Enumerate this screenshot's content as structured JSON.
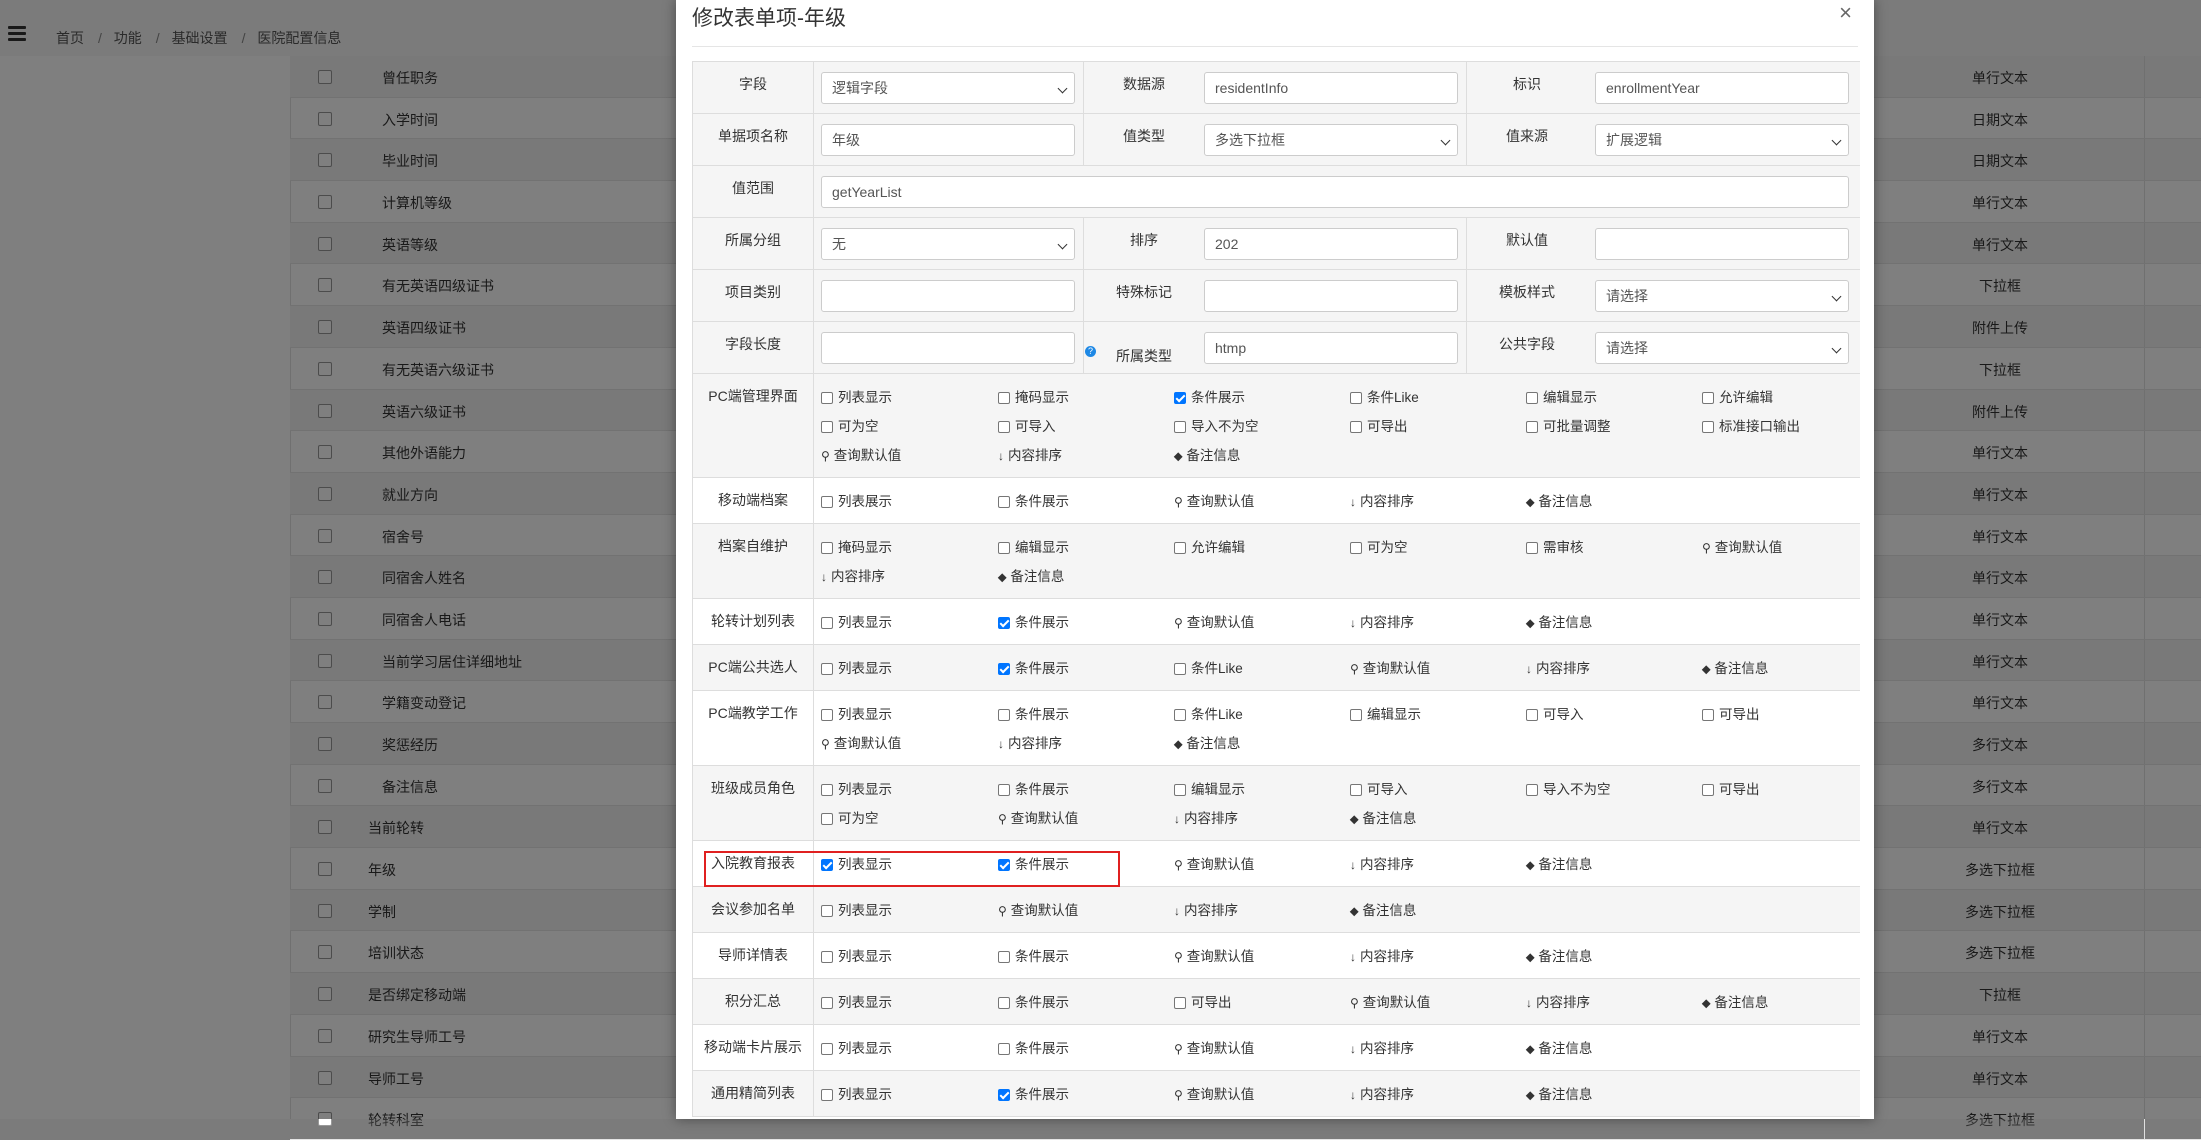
{
  "breadcrumb": [
    "首页",
    "功能",
    "基础设置",
    "医院配置信息"
  ],
  "background_rows": [
    {
      "name": "曾任职务",
      "type": "单行文本",
      "indent": true
    },
    {
      "name": "入学时间",
      "type": "日期文本",
      "indent": true
    },
    {
      "name": "毕业时间",
      "type": "日期文本",
      "indent": true
    },
    {
      "name": "计算机等级",
      "type": "单行文本",
      "indent": true
    },
    {
      "name": "英语等级",
      "type": "单行文本",
      "indent": true
    },
    {
      "name": "有无英语四级证书",
      "type": "下拉框",
      "indent": true
    },
    {
      "name": "英语四级证书",
      "type": "附件上传",
      "indent": true
    },
    {
      "name": "有无英语六级证书",
      "type": "下拉框",
      "indent": true
    },
    {
      "name": "英语六级证书",
      "type": "附件上传",
      "indent": true
    },
    {
      "name": "其他外语能力",
      "type": "单行文本",
      "indent": true
    },
    {
      "name": "就业方向",
      "type": "单行文本",
      "indent": true
    },
    {
      "name": "宿舍号",
      "type": "单行文本",
      "indent": true
    },
    {
      "name": "同宿舍人姓名",
      "type": "单行文本",
      "indent": true
    },
    {
      "name": "同宿舍人电话",
      "type": "单行文本",
      "indent": true
    },
    {
      "name": "当前学习居住详细地址",
      "type": "单行文本",
      "indent": true
    },
    {
      "name": "学籍变动登记",
      "type": "单行文本",
      "indent": true
    },
    {
      "name": "奖惩经历",
      "type": "多行文本",
      "indent": true
    },
    {
      "name": "备注信息",
      "type": "多行文本",
      "indent": true
    },
    {
      "name": "当前轮转",
      "type": "单行文本",
      "indent": false
    },
    {
      "name": "年级",
      "type": "多选下拉框",
      "indent": false
    },
    {
      "name": "学制",
      "type": "多选下拉框",
      "indent": false
    },
    {
      "name": "培训状态",
      "type": "多选下拉框",
      "indent": false
    },
    {
      "name": "是否绑定移动端",
      "type": "下拉框",
      "indent": false
    },
    {
      "name": "研究生导师工号",
      "type": "单行文本",
      "indent": false
    },
    {
      "name": "导师工号",
      "type": "单行文本",
      "indent": false
    },
    {
      "name": "轮转科室",
      "type": "多选下拉框",
      "indent": false
    }
  ],
  "modal": {
    "title": "修改表单项-年级",
    "close": "×",
    "fields": {
      "field_label": "字段",
      "field_value": "逻辑字段",
      "datasource_label": "数据源",
      "datasource_value": "residentInfo",
      "identifier_label": "标识",
      "identifier_value": "enrollmentYear",
      "name_label": "单据项名称",
      "name_value": "年级",
      "valtype_label": "值类型",
      "valtype_value": "多选下拉框",
      "valsource_label": "值来源",
      "valsource_value": "扩展逻辑",
      "range_label": "值范围",
      "range_value": "getYearList",
      "group_label": "所属分组",
      "group_value": "无",
      "order_label": "排序",
      "order_value": "202",
      "default_label": "默认值",
      "default_value": "",
      "category_label": "项目类别",
      "category_value": "",
      "special_label": "特殊标记",
      "special_value": "",
      "template_label": "模板样式",
      "template_value": "请选择",
      "length_label": "字段长度",
      "length_value": "",
      "owntype_label": "所属类型",
      "owntype_help": "?",
      "owntype_value": "htmp",
      "public_label": "公共字段",
      "public_value": "请选择"
    },
    "sections": [
      {
        "label": "PC端管理界面",
        "items": [
          {
            "t": "c",
            "text": "列表显示",
            "on": false
          },
          {
            "t": "c",
            "text": "掩码显示",
            "on": false
          },
          {
            "t": "c",
            "text": "条件展示",
            "on": true
          },
          {
            "t": "c",
            "text": "条件Like",
            "on": false
          },
          {
            "t": "c",
            "text": "编辑显示",
            "on": false
          },
          {
            "t": "c",
            "text": "允许编辑",
            "on": false
          },
          {
            "t": "c",
            "text": "可为空",
            "on": false
          },
          {
            "t": "c",
            "text": "可导入",
            "on": false
          },
          {
            "t": "c",
            "text": "导入不为空",
            "on": false
          },
          {
            "t": "c",
            "text": "可导出",
            "on": false
          },
          {
            "t": "c",
            "text": "可批量调整",
            "on": false
          },
          {
            "t": "c",
            "text": "标准接口输出",
            "on": false
          },
          {
            "t": "q",
            "text": "查询默认值"
          },
          {
            "t": "s",
            "text": "内容排序"
          },
          {
            "t": "g",
            "text": "备注信息"
          }
        ]
      },
      {
        "label": "移动端档案",
        "items": [
          {
            "t": "c",
            "text": "列表展示",
            "on": false
          },
          {
            "t": "c",
            "text": "条件展示",
            "on": false
          },
          {
            "t": "q",
            "text": "查询默认值"
          },
          {
            "t": "s",
            "text": "内容排序"
          },
          {
            "t": "g",
            "text": "备注信息"
          }
        ]
      },
      {
        "label": "档案自维护",
        "items": [
          {
            "t": "c",
            "text": "掩码显示",
            "on": false
          },
          {
            "t": "c",
            "text": "编辑显示",
            "on": false
          },
          {
            "t": "c",
            "text": "允许编辑",
            "on": false
          },
          {
            "t": "c",
            "text": "可为空",
            "on": false
          },
          {
            "t": "c",
            "text": "需审核",
            "on": false
          },
          {
            "t": "q",
            "text": "查询默认值"
          },
          {
            "t": "s",
            "text": "内容排序"
          },
          {
            "t": "g",
            "text": "备注信息"
          }
        ]
      },
      {
        "label": "轮转计划列表",
        "items": [
          {
            "t": "c",
            "text": "列表显示",
            "on": false
          },
          {
            "t": "c",
            "text": "条件展示",
            "on": true
          },
          {
            "t": "q",
            "text": "查询默认值"
          },
          {
            "t": "s",
            "text": "内容排序"
          },
          {
            "t": "g",
            "text": "备注信息"
          }
        ]
      },
      {
        "label": "PC端公共选人",
        "items": [
          {
            "t": "c",
            "text": "列表显示",
            "on": false
          },
          {
            "t": "c",
            "text": "条件展示",
            "on": true
          },
          {
            "t": "c",
            "text": "条件Like",
            "on": false
          },
          {
            "t": "q",
            "text": "查询默认值"
          },
          {
            "t": "s",
            "text": "内容排序"
          },
          {
            "t": "g",
            "text": "备注信息"
          }
        ]
      },
      {
        "label": "PC端教学工作",
        "items": [
          {
            "t": "c",
            "text": "列表显示",
            "on": false
          },
          {
            "t": "c",
            "text": "条件展示",
            "on": false
          },
          {
            "t": "c",
            "text": "条件Like",
            "on": false
          },
          {
            "t": "c",
            "text": "编辑显示",
            "on": false
          },
          {
            "t": "c",
            "text": "可导入",
            "on": false
          },
          {
            "t": "c",
            "text": "可导出",
            "on": false
          },
          {
            "t": "q",
            "text": "查询默认值"
          },
          {
            "t": "s",
            "text": "内容排序"
          },
          {
            "t": "g",
            "text": "备注信息"
          }
        ]
      },
      {
        "label": "班级成员角色",
        "items": [
          {
            "t": "c",
            "text": "列表显示",
            "on": false
          },
          {
            "t": "c",
            "text": "条件展示",
            "on": false
          },
          {
            "t": "c",
            "text": "编辑显示",
            "on": false
          },
          {
            "t": "c",
            "text": "可导入",
            "on": false
          },
          {
            "t": "c",
            "text": "导入不为空",
            "on": false
          },
          {
            "t": "c",
            "text": "可导出",
            "on": false
          },
          {
            "t": "c",
            "text": "可为空",
            "on": false
          },
          {
            "t": "q",
            "text": "查询默认值"
          },
          {
            "t": "s",
            "text": "内容排序"
          },
          {
            "t": "g",
            "text": "备注信息"
          }
        ]
      },
      {
        "label": "入院教育报表",
        "items": [
          {
            "t": "c",
            "text": "列表显示",
            "on": true
          },
          {
            "t": "c",
            "text": "条件展示",
            "on": true
          },
          {
            "t": "q",
            "text": "查询默认值"
          },
          {
            "t": "s",
            "text": "内容排序"
          },
          {
            "t": "g",
            "text": "备注信息"
          }
        ]
      },
      {
        "label": "会议参加名单",
        "items": [
          {
            "t": "c",
            "text": "列表显示",
            "on": false
          },
          {
            "t": "q",
            "text": "查询默认值"
          },
          {
            "t": "s",
            "text": "内容排序"
          },
          {
            "t": "g",
            "text": "备注信息"
          }
        ]
      },
      {
        "label": "导师详情表",
        "items": [
          {
            "t": "c",
            "text": "列表显示",
            "on": false
          },
          {
            "t": "c",
            "text": "条件展示",
            "on": false
          },
          {
            "t": "q",
            "text": "查询默认值"
          },
          {
            "t": "s",
            "text": "内容排序"
          },
          {
            "t": "g",
            "text": "备注信息"
          }
        ]
      },
      {
        "label": "积分汇总",
        "items": [
          {
            "t": "c",
            "text": "列表显示",
            "on": false
          },
          {
            "t": "c",
            "text": "条件展示",
            "on": false
          },
          {
            "t": "c",
            "text": "可导出",
            "on": false
          },
          {
            "t": "q",
            "text": "查询默认值"
          },
          {
            "t": "s",
            "text": "内容排序"
          },
          {
            "t": "g",
            "text": "备注信息"
          }
        ]
      },
      {
        "label": "移动端卡片展示",
        "items": [
          {
            "t": "c",
            "text": "列表显示",
            "on": false
          },
          {
            "t": "c",
            "text": "条件展示",
            "on": false
          },
          {
            "t": "q",
            "text": "查询默认值"
          },
          {
            "t": "s",
            "text": "内容排序"
          },
          {
            "t": "g",
            "text": "备注信息"
          }
        ]
      },
      {
        "label": "通用精简列表",
        "items": [
          {
            "t": "c",
            "text": "列表显示",
            "on": false
          },
          {
            "t": "c",
            "text": "条件展示",
            "on": true
          },
          {
            "t": "q",
            "text": "查询默认值"
          },
          {
            "t": "s",
            "text": "内容排序"
          },
          {
            "t": "g",
            "text": "备注信息"
          }
        ]
      }
    ]
  },
  "colors": {
    "accent": "#0075ff",
    "highlight": "#e02020",
    "help": "#1e88e5"
  }
}
